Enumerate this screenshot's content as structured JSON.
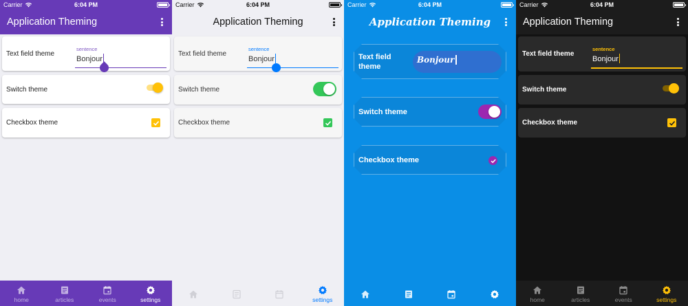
{
  "status": {
    "carrier": "Carrier",
    "time": "6:04 PM"
  },
  "app": {
    "title": "Application Theming"
  },
  "cards": {
    "text_field": {
      "label": "Text field theme",
      "float_label": "sentence",
      "value": "Bonjour"
    },
    "switch": {
      "label": "Switch theme"
    },
    "checkbox": {
      "label": "Checkbox theme"
    }
  },
  "tabs": [
    {
      "label": "home",
      "icon": "home-icon"
    },
    {
      "label": "articles",
      "icon": "articles-icon"
    },
    {
      "label": "events",
      "icon": "calendar-icon"
    },
    {
      "label": "settings",
      "icon": "gear-icon"
    }
  ],
  "themes": [
    {
      "name": "material-purple",
      "accent": "#673ab7",
      "switch_color": "#ffc107",
      "checkbox_color": "#ffc107"
    },
    {
      "name": "cupertino",
      "accent": "#007aff",
      "switch_color": "#34c759",
      "checkbox_color": "#34c759"
    },
    {
      "name": "custom-blue",
      "accent": "#0a8ee6",
      "switch_color": "#9c27b0",
      "checkbox_color": "#9c27b0"
    },
    {
      "name": "dark",
      "accent": "#ffc107",
      "switch_color": "#ffc107",
      "checkbox_color": "#ffc107"
    }
  ]
}
